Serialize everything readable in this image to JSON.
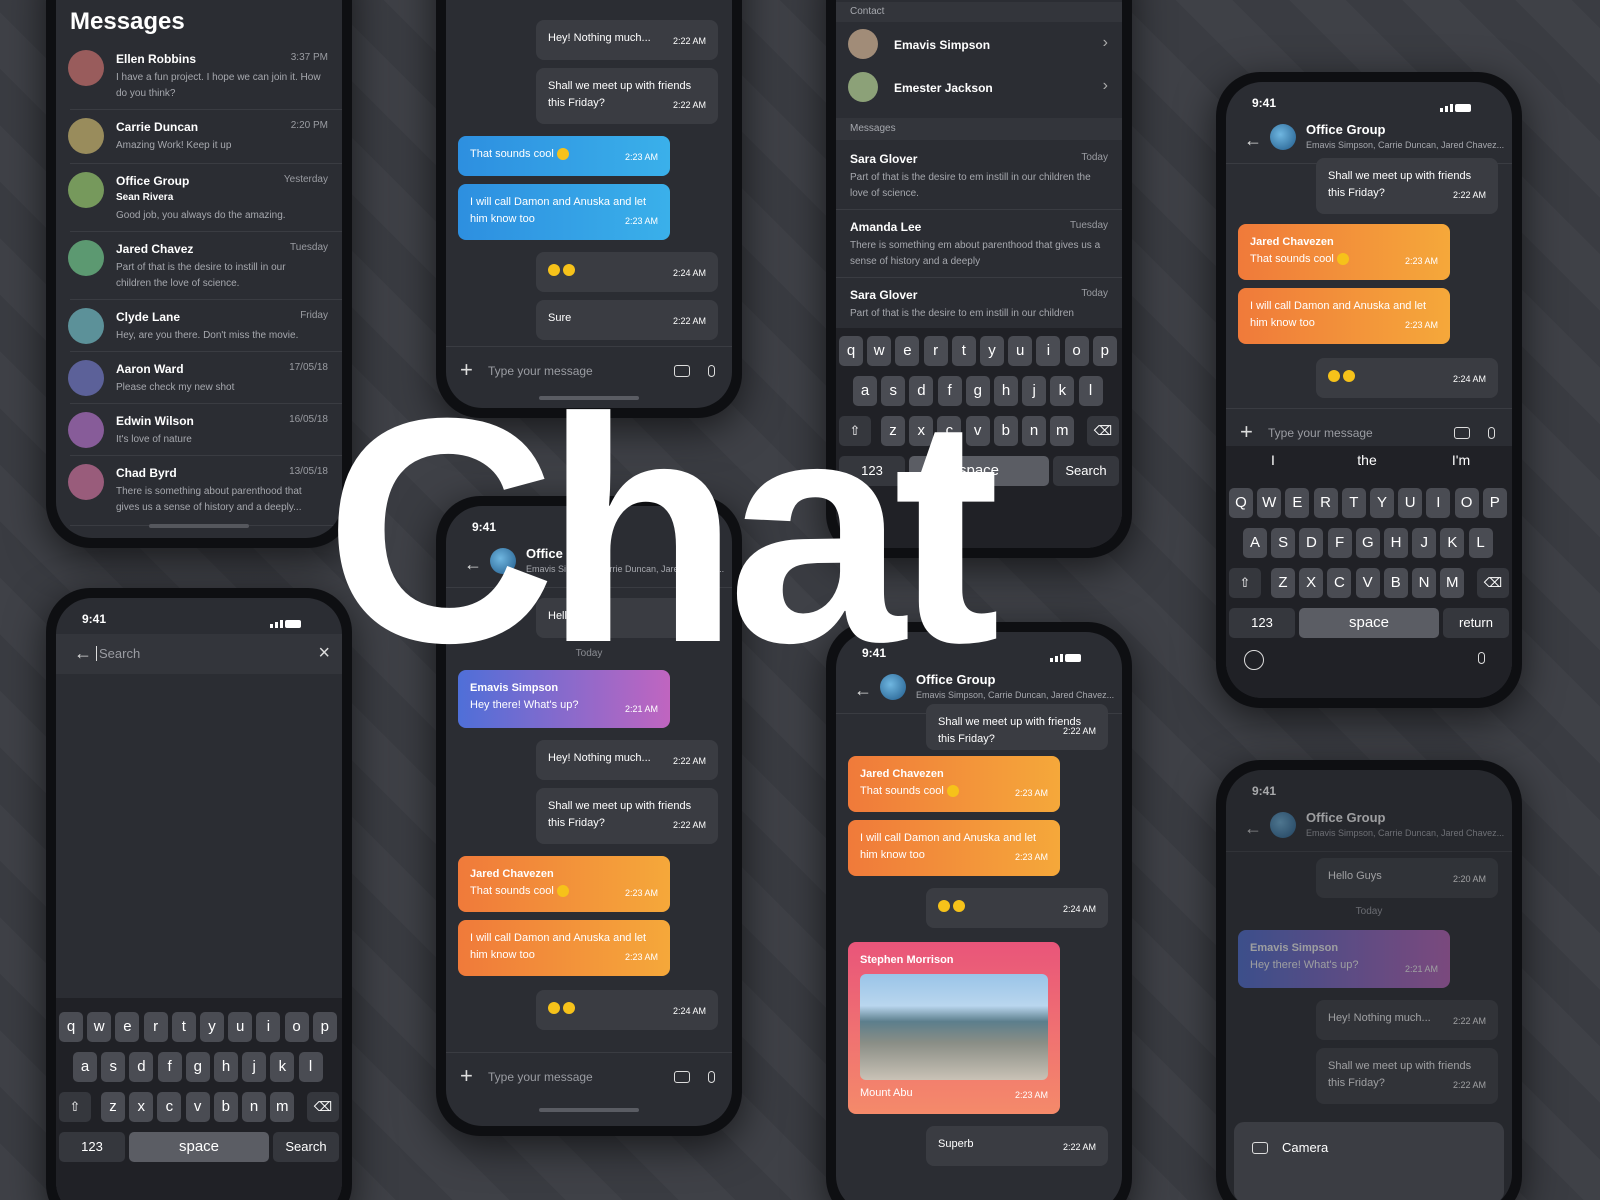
{
  "headline": "Chat",
  "status_time": "9:41",
  "messages_screen": {
    "title": "Messages",
    "items": [
      {
        "name": "Ellen Robbins",
        "time": "3:37 PM",
        "msg": "I have a fun project. I hope we can join it. How do you think?"
      },
      {
        "name": "Carrie Duncan",
        "time": "2:20 PM",
        "msg": "Amazing Work! Keep it up"
      },
      {
        "name": "Office Group",
        "time": "Yesterday",
        "sender": "Sean Rivera",
        "msg": "Good job, you always do the amazing."
      },
      {
        "name": "Jared Chavez",
        "time": "Tuesday",
        "msg": "Part of that is the desire to instill in our children the love of science."
      },
      {
        "name": "Clyde Lane",
        "time": "Friday",
        "msg": "Hey, are you there. Don't miss the movie."
      },
      {
        "name": "Aaron Ward",
        "time": "17/05/18",
        "msg": "Please check my new shot"
      },
      {
        "name": "Edwin Wilson",
        "time": "16/05/18",
        "msg": "It's love of nature"
      },
      {
        "name": "Chad Byrd",
        "time": "13/05/18",
        "msg": "There is something about parenthood that gives us a sense of history and a deeply..."
      }
    ]
  },
  "chat": {
    "group_title": "Office Group",
    "group_members": "Emavis Simpson, Carrie Duncan, Jared Chavez...",
    "input_placeholder": "Type your message",
    "today": "Today",
    "hello": {
      "text": "Hello Guys",
      "time": "2:20 AM"
    },
    "emavis": {
      "name": "Emavis Simpson",
      "text": "Hey there! What's up?",
      "time": "2:21 AM"
    },
    "nothing": {
      "text": "Hey! Nothing much...",
      "time": "2:22 AM"
    },
    "meetup": {
      "text": "Shall we meet up with friends this Friday?",
      "time": "2:22 AM"
    },
    "jared": {
      "name": "Jared Chavezen",
      "text": "That sounds cool",
      "time": "2:23 AM"
    },
    "call": {
      "text": "I will call Damon and Anuska and let him know too",
      "time": "2:23 AM"
    },
    "emoji_time": "2:24 AM",
    "sure": {
      "text": "Sure",
      "time": "2:22 AM"
    },
    "stephen": {
      "name": "Stephen Morrison",
      "caption": "Mount Abu",
      "time": "2:23 AM"
    },
    "superb": {
      "text": "Superb",
      "time": "2:22 AM"
    }
  },
  "search_screen": {
    "placeholder": "Search"
  },
  "contacts_screen": {
    "contact_header": "Contact",
    "contacts": [
      "Emavis Simpson",
      "Emester Jackson"
    ],
    "messages_header": "Messages",
    "results": [
      {
        "name": "Sara Glover",
        "time": "Today",
        "msg": "Part of that is the desire to em instill in our children the love of science."
      },
      {
        "name": "Amanda Lee",
        "time": "Tuesday",
        "msg": "There is something em about parenthood that gives us a sense of history and a deeply"
      },
      {
        "name": "Sara Glover",
        "time": "Today",
        "msg": "Part of that is the desire to em instill in our children"
      }
    ]
  },
  "keyboard": {
    "row1": [
      "q",
      "w",
      "e",
      "r",
      "t",
      "y",
      "u",
      "i",
      "o",
      "p"
    ],
    "row2": [
      "a",
      "s",
      "d",
      "f",
      "g",
      "h",
      "j",
      "k",
      "l"
    ],
    "row3": [
      "z",
      "x",
      "c",
      "v",
      "b",
      "n",
      "m"
    ],
    "row1_upper": [
      "Q",
      "W",
      "E",
      "R",
      "T",
      "Y",
      "U",
      "I",
      "O",
      "P"
    ],
    "row2_upper": [
      "A",
      "S",
      "D",
      "F",
      "G",
      "H",
      "J",
      "K",
      "L"
    ],
    "row3_upper": [
      "Z",
      "X",
      "C",
      "V",
      "B",
      "N",
      "M"
    ],
    "num": "123",
    "space": "space",
    "search": "Search",
    "return": "return",
    "suggestions": [
      "I",
      "the",
      "I'm"
    ]
  },
  "camera_label": "Camera",
  "colors": {
    "bg": "#3c3e44",
    "screen": "#2b2d33",
    "blue": "#2d8fe0",
    "orange": "#f5a83a",
    "pink": "#e9557a"
  }
}
